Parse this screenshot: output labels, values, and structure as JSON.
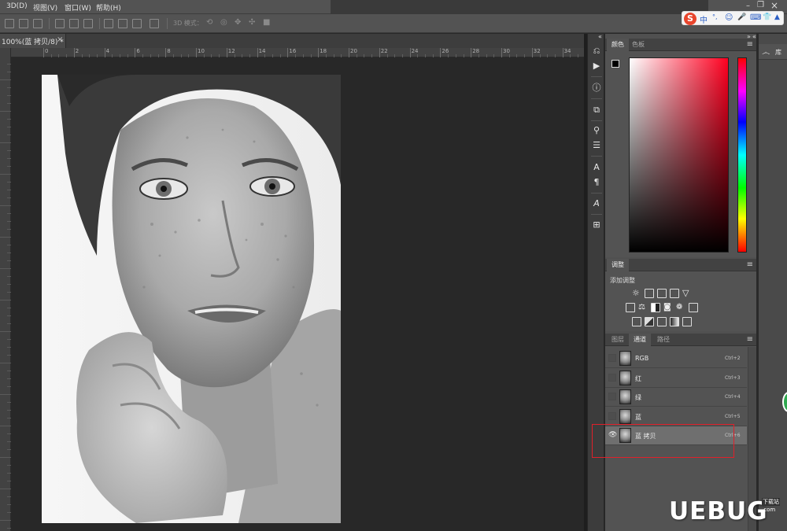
{
  "menubar": {
    "items": [
      "3D(D)",
      "视图(V)",
      "窗口(W)",
      "帮助(H)"
    ]
  },
  "optionsbar": {
    "mode_3d_label": "3D 模式："
  },
  "ime": {
    "logo": "S",
    "lang": "中",
    "glyphs": [
      "°,",
      "☺",
      "🎤",
      "⌨",
      "👕",
      "▲"
    ]
  },
  "document": {
    "tab_label": "100%(蓝 拷贝/8) *",
    "close_glyph": "×"
  },
  "ruler": {
    "labels": [
      "0",
      "2",
      "4",
      "6",
      "8",
      "10",
      "12",
      "14",
      "16",
      "18",
      "20",
      "22",
      "24",
      "26",
      "28",
      "30",
      "32",
      "34"
    ]
  },
  "color_panel": {
    "tabs": [
      "颜色",
      "色板"
    ],
    "menu_glyph": "≡"
  },
  "adjust_panel": {
    "tab": "调整",
    "title": "添加调整"
  },
  "channels_panel": {
    "tabs": [
      "图层",
      "通道",
      "路径"
    ],
    "active_tab": "通道",
    "rows": [
      {
        "name": "RGB",
        "shortcut": "Ctrl+2",
        "visible": false,
        "selected": false
      },
      {
        "name": "红",
        "shortcut": "Ctrl+3",
        "visible": false,
        "selected": false
      },
      {
        "name": "绿",
        "shortcut": "Ctrl+4",
        "visible": false,
        "selected": false
      },
      {
        "name": "蓝",
        "shortcut": "Ctrl+5",
        "visible": false,
        "selected": false
      },
      {
        "name": "蓝 拷贝",
        "shortcut": "Ctrl+6",
        "visible": true,
        "selected": true
      }
    ]
  },
  "library": {
    "label": "库"
  },
  "watermark": {
    "text": "UEBUG",
    "badge": "下载站",
    "url": ".com"
  },
  "colors": {
    "accent_red": "#e0202a",
    "ps_panel": "#535353",
    "canvas_bg": "#282828"
  }
}
